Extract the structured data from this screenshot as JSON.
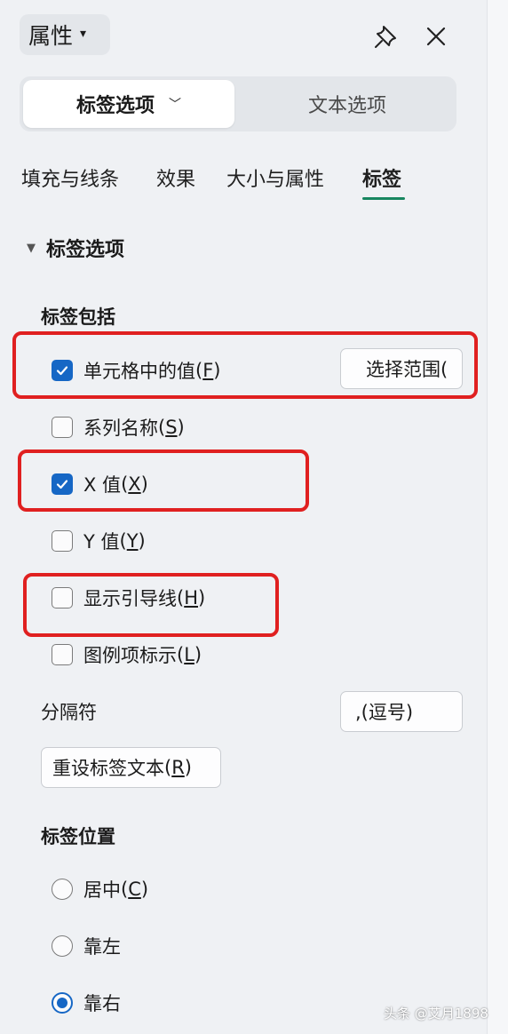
{
  "header": {
    "title": "属性"
  },
  "segmented": {
    "active_label": "标签选项",
    "inactive_label": "文本选项"
  },
  "tabs": [
    {
      "label": "填充与线条"
    },
    {
      "label": "效果"
    },
    {
      "label": "大小与属性"
    },
    {
      "label": "标签",
      "active": true
    }
  ],
  "section": {
    "title": "标签选项"
  },
  "label_includes": {
    "title": "标签包括",
    "items": [
      {
        "label": "单元格中的值",
        "key": "F",
        "checked": true
      },
      {
        "label": "系列名称",
        "key": "S",
        "checked": false
      },
      {
        "label": "X 值",
        "key": "X",
        "checked": true
      },
      {
        "label": "Y 值",
        "key": "Y",
        "checked": false
      },
      {
        "label": "显示引导线",
        "key": "H",
        "checked": false
      },
      {
        "label": "图例项标示",
        "key": "L",
        "checked": false
      }
    ],
    "select_range_button": "选择范围("
  },
  "separator": {
    "label": "分隔符",
    "value": ",(逗号)"
  },
  "reset_button": {
    "label": "重设标签文本",
    "key": "R"
  },
  "label_position": {
    "title": "标签位置",
    "options": [
      {
        "label": "居中",
        "key": "C",
        "selected": false
      },
      {
        "label": "靠左",
        "key": "",
        "selected": false
      },
      {
        "label": "靠右",
        "key": "",
        "selected": true
      }
    ]
  },
  "watermark": "头条 @艾月1898",
  "colors": {
    "accent": "#17865f",
    "checkbox": "#1667c5",
    "highlight": "#e02020"
  }
}
